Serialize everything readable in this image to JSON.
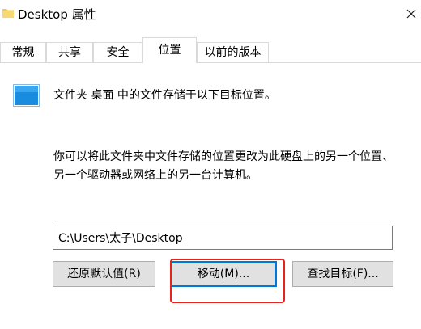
{
  "window": {
    "title": "Desktop 属性",
    "close_glyph": "✕",
    "icon": "folder-icon"
  },
  "tabs": [
    {
      "label": "常规",
      "active": false
    },
    {
      "label": "共享",
      "active": false
    },
    {
      "label": "安全",
      "active": false
    },
    {
      "label": "位置",
      "active": true
    },
    {
      "label": "以前的版本",
      "active": false
    }
  ],
  "location_tab": {
    "intro": "文件夹 桌面 中的文件存储于以下目标位置。",
    "description": "你可以将此文件夹中文件存储的位置更改为此硬盘上的另一个位置、另一个驱动器或网络上的另一台计算机。",
    "path_value": "C:\\Users\\太子\\Desktop",
    "buttons": {
      "restore": "还原默认值(R)",
      "move": "移动(M)...",
      "find_target": "查找目标(F)..."
    }
  },
  "colors": {
    "accent": "#0078d7",
    "annotation": "#e8231b",
    "folder_yellow": "#f2c94c",
    "desktop_blue": "#1a8ce0"
  }
}
